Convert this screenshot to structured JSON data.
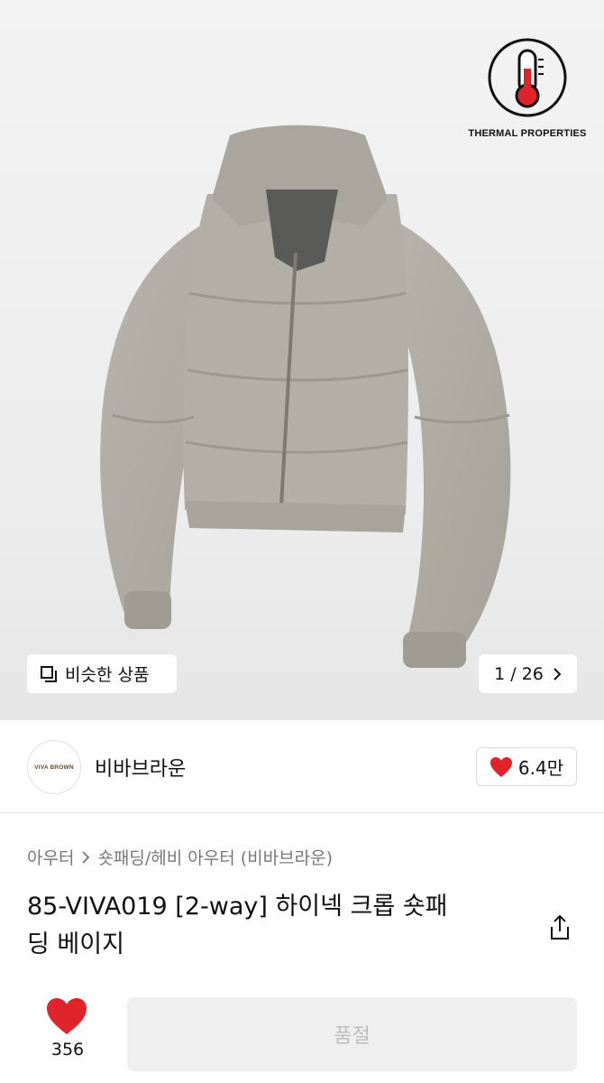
{
  "hero": {
    "badge_label": "THERMAL PROPERTIES",
    "badge_icon": "thermometer-icon",
    "similar_label": "비슷한 상품",
    "counter_label": "1 / 26"
  },
  "brand": {
    "logo_text": "VIVA BROWN",
    "name": "비바브라운",
    "like_count": "6.4만"
  },
  "product": {
    "breadcrumb": [
      "아우터",
      "숏패딩/헤비 아우터 (비바브라운)"
    ],
    "title_line1": "85-VIVA019 [2-way] 하이넥 크롭 숏패",
    "title_line2": "딩 베이지"
  },
  "bottom": {
    "like_count": "356",
    "buy_label": "품절"
  },
  "colors": {
    "accent_red": "#e0242b",
    "soldout_bg": "#efefef",
    "soldout_text": "#bdbdbd"
  }
}
